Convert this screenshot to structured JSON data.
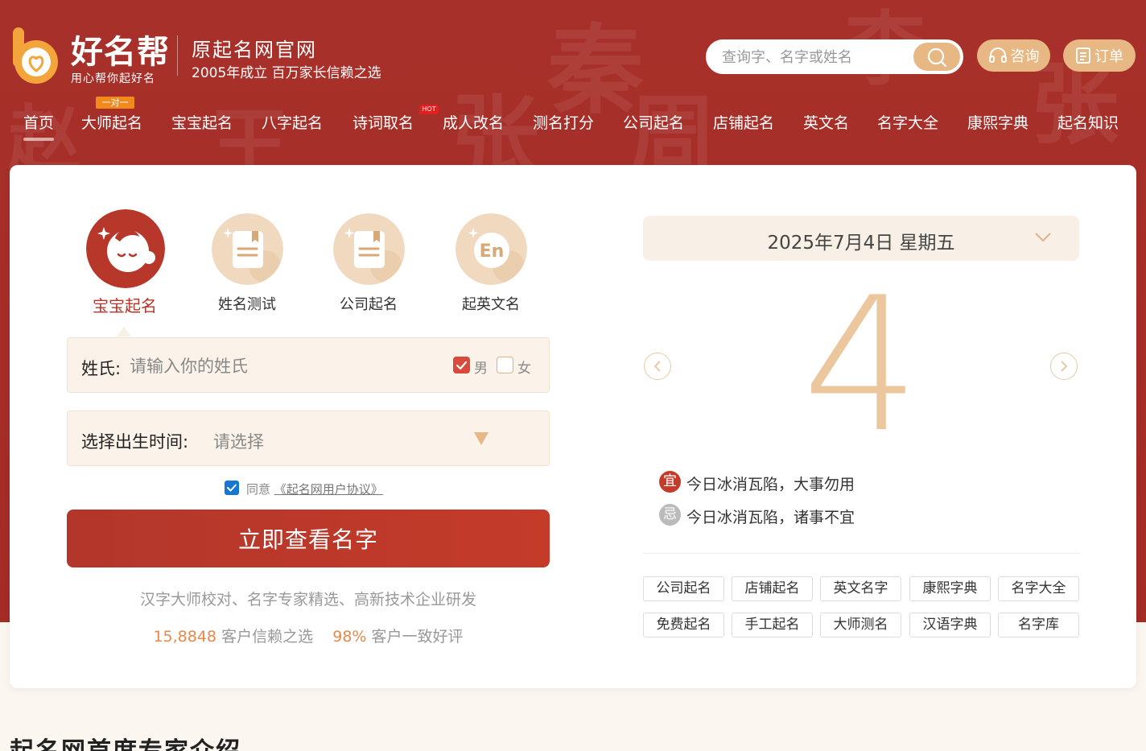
{
  "brand": {
    "name": "好名帮",
    "slogan": "用心帮你起好名",
    "site_name": "原起名网官网",
    "site_slogan": "2005年成立 百万家长信赖之选"
  },
  "header": {
    "search_placeholder": "查询字、名字或姓名",
    "consult_label": "咨询",
    "order_label": "订单"
  },
  "nav": {
    "items": [
      "首页",
      "大师起名",
      "宝宝起名",
      "八字起名",
      "诗词取名",
      "成人改名",
      "测名打分",
      "公司起名",
      "店铺起名",
      "英文名",
      "名字大全",
      "康熙字典",
      "起名知识"
    ],
    "badge_1v1": "一对一",
    "badge_hot": "HOT"
  },
  "tabs": [
    {
      "label": "宝宝起名",
      "icon": "baby-face-icon",
      "active": true
    },
    {
      "label": "姓名测试",
      "icon": "book-icon",
      "active": false
    },
    {
      "label": "公司起名",
      "icon": "book-icon",
      "active": false
    },
    {
      "label": "起英文名",
      "icon": "en-icon",
      "active": false
    }
  ],
  "form": {
    "surname_label": "姓氏:",
    "surname_placeholder": "请输入你的姓氏",
    "gender_male": "男",
    "gender_female": "女",
    "gender_selected": "男",
    "birth_label": "选择出生时间:",
    "birth_placeholder": "请选择",
    "agree_prefix": "同意",
    "agree_link": "《起名网用户协议》",
    "agree_checked": true,
    "submit_label": "立即查看名字",
    "tagline": "汉字大师校对、名字专家精选、高新技术企业研发",
    "stat1_num": "15,8848",
    "stat1_text": "客户信赖之选",
    "stat2_num": "98%",
    "stat2_text": "客户一致好评"
  },
  "calendar": {
    "date_text": "2025年7月4日 星期五",
    "day": "4",
    "yi_label": "宜",
    "yi_text": "今日冰消瓦陷，大事勿用",
    "ji_label": "忌",
    "ji_text": "今日冰消瓦陷，诸事不宜"
  },
  "tags": [
    "公司起名",
    "店铺起名",
    "英文名字",
    "康熙字典",
    "名字大全",
    "免费起名",
    "手工起名",
    "大师测名",
    "汉语字典",
    "名字库"
  ],
  "section_title": "起名网首席专家介绍",
  "colors": {
    "primary_red": "#a8302a",
    "accent_gold": "#e8b884",
    "button_red": "#b3362b"
  }
}
